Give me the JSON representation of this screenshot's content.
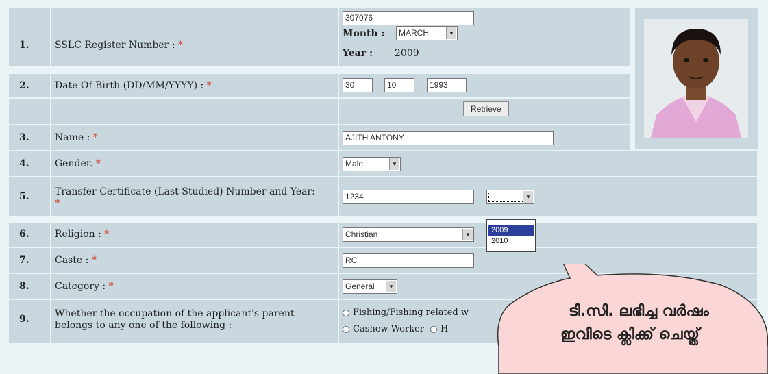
{
  "header": {
    "fragment": "....."
  },
  "rows": [
    {
      "num": "1.",
      "label": "SSLC Register Number :",
      "req": "*"
    },
    {
      "num": "2.",
      "label": "Date Of Birth (DD/MM/YYYY) :",
      "req": "*"
    },
    {
      "num": "",
      "label": "",
      "req": ""
    },
    {
      "num": "3.",
      "label": "Name :",
      "req": "*"
    },
    {
      "num": "4.",
      "label": "Gender.",
      "req": "*"
    },
    {
      "num": "5.",
      "label": "Transfer Certificate (Last Studied) Number and Year:",
      "req": "*"
    },
    {
      "num": "6.",
      "label": "Religion :",
      "req": "*"
    },
    {
      "num": "7.",
      "label": "Caste :",
      "req": "*"
    },
    {
      "num": "8.",
      "label": "Category :",
      "req": "*"
    },
    {
      "num": "9.",
      "label": "Whether the occupation of the applicant's parent belongs to any one of the following :",
      "req": ""
    }
  ],
  "sslc": {
    "register_value": "307076",
    "month_label": "Month :",
    "month_value": "MARCH",
    "year_label": "Year :",
    "year_value": "2009"
  },
  "dob": {
    "day": "30",
    "month": "10",
    "year": "1993"
  },
  "retrieve_label": "Retrieve",
  "name_value": "AJITH ANTONY",
  "gender_value": "Male",
  "tc": {
    "number_value": "1234",
    "year_selected": "",
    "year_options": [
      "2009",
      "2010"
    ],
    "highlighted_option": "2009"
  },
  "religion_value": "Christian",
  "caste_value": "RC",
  "category_value": "General",
  "occupation": {
    "options": [
      "Fishing/Fishing related w",
      "Cashew Worker",
      "H"
    ]
  },
  "callout": {
    "line1": "ടി.സി. ലഭിച്ച വർഷം",
    "line2": "ഇവിടെ ക്ലിക്ക് ചെയ്ത്"
  },
  "colors": {
    "row_bg": "#c9d8de",
    "page_bg": "#eaf3f6",
    "required": "#d43a2a",
    "highlight": "#2b3f9c",
    "bubble_fill": "#fbd6d6"
  }
}
